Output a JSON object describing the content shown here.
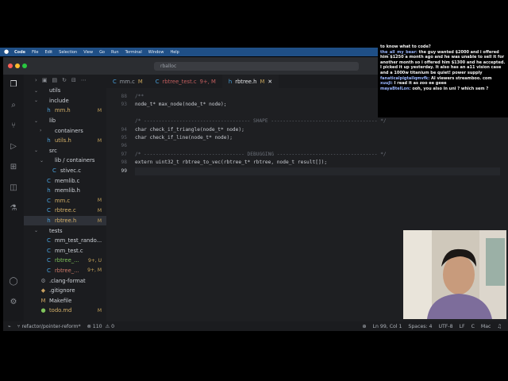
{
  "menubar": {
    "app": "Code",
    "items": [
      "File",
      "Edit",
      "Selection",
      "View",
      "Go",
      "Run",
      "Terminal",
      "Window",
      "Help"
    ]
  },
  "search": {
    "placeholder": "rballoc"
  },
  "sidebar": {
    "rows": [
      {
        "label": "utils",
        "type": "folder",
        "open": true,
        "level": 1,
        "badge": ""
      },
      {
        "label": "include",
        "type": "folder",
        "open": true,
        "level": 1,
        "badge": ""
      },
      {
        "label": "mm.h",
        "type": "h",
        "level": 2,
        "badge": "M"
      },
      {
        "label": "lib",
        "type": "folder",
        "open": true,
        "level": 1,
        "badge": ""
      },
      {
        "label": "containers",
        "type": "folder",
        "open": false,
        "level": 2,
        "badge": ""
      },
      {
        "label": "utils.h",
        "type": "h",
        "level": 2,
        "badge": "M"
      },
      {
        "label": "src",
        "type": "folder",
        "open": true,
        "level": 1,
        "badge": ""
      },
      {
        "label": "lib / containers",
        "type": "folder",
        "open": true,
        "level": 2,
        "badge": ""
      },
      {
        "label": "stivec.c",
        "type": "c",
        "level": 3,
        "badge": ""
      },
      {
        "label": "memlib.c",
        "type": "c",
        "level": 2,
        "badge": ""
      },
      {
        "label": "memlib.h",
        "type": "h",
        "level": 2,
        "badge": ""
      },
      {
        "label": "mm.c",
        "type": "c",
        "level": 2,
        "badge": "M"
      },
      {
        "label": "rbtree.c",
        "type": "c",
        "level": 2,
        "badge": "M"
      },
      {
        "label": "rbtree.h",
        "type": "h",
        "level": 2,
        "badge": "M",
        "active": true
      },
      {
        "label": "tests",
        "type": "folder",
        "open": true,
        "level": 1,
        "badge": ""
      },
      {
        "label": "mm_test_rando...",
        "type": "c",
        "level": 2,
        "badge": ""
      },
      {
        "label": "mm_test.c",
        "type": "c",
        "level": 2,
        "badge": ""
      },
      {
        "label": "rbtree_...",
        "type": "c",
        "level": 2,
        "badge": "9+, U"
      },
      {
        "label": "rbtree_...",
        "type": "c",
        "level": 2,
        "badge": "9+, M"
      },
      {
        "label": ".clang-format",
        "type": "cfg",
        "level": 1,
        "badge": ""
      },
      {
        "label": ".gitignore",
        "type": "git",
        "level": 1,
        "badge": ""
      },
      {
        "label": "Makefile",
        "type": "make",
        "level": 1,
        "badge": ""
      },
      {
        "label": "todo.md",
        "type": "md",
        "level": 1,
        "badge": "M"
      }
    ]
  },
  "tabs": [
    {
      "icon": "C",
      "name": "mm.c",
      "status": "M",
      "active": false
    },
    {
      "icon": "C",
      "name": "rbtree_test.c",
      "status": "9+, M",
      "active": false
    },
    {
      "icon": "h",
      "name": "rbtree.h",
      "status": "M",
      "active": true
    }
  ],
  "code": {
    "lines": [
      {
        "n": "88",
        "text": "/**",
        "kind": "cm"
      },
      {
        "n": "93",
        "text": "node_t* max_node(node_t* node);",
        "kind": "code"
      },
      {
        "n": "",
        "text": "",
        "kind": "code"
      },
      {
        "n": "",
        "text": "/* ------------------------------------ SHAPE ------------------------------------ */",
        "kind": "cm"
      },
      {
        "n": "94",
        "text": "char check_if_triangle(node_t* node);",
        "kind": "code"
      },
      {
        "n": "95",
        "text": "char check_if_line(node_t* node);",
        "kind": "code"
      },
      {
        "n": "96",
        "text": "",
        "kind": "code"
      },
      {
        "n": "97",
        "text": "/* ---------------------------------- DEBUGGING ---------------------------------- */",
        "kind": "cm"
      },
      {
        "n": "98",
        "text": "extern uint32_t rbtree_to_vec(rbtree_t* rbtree, node_t result[]);",
        "kind": "code"
      },
      {
        "n": "99",
        "text": "",
        "kind": "cur"
      }
    ]
  },
  "statusbar": {
    "branch": "refactor/pointer-reform*",
    "problems": "110",
    "warnings": "0",
    "position": "Ln 99, Col 1",
    "spaces": "Spaces: 4",
    "encoding": "UTF-8",
    "eol": "LF",
    "lang": "C",
    "platform": "Mac"
  },
  "chat": {
    "lines": [
      {
        "user": "",
        "text": "to know what to code?"
      },
      {
        "user": "the_all_my_bear:",
        "text": "the guy wanted $2000 and i offered him $1250 a month ago and he was unable to sell it for another month so i offered him $1300 and he accepted. I picked it up yesterday. It also has an a11 vision case and a 1000w titanium be quiet! power supply"
      },
      {
        "user": "fanaticalpigtailqmvfk:",
        "text": "AI viewers streamboo. com"
      },
      {
        "user": "xuuJi:",
        "text": "I read it as zoo ee geee"
      },
      {
        "user": "mayaBtelLon:",
        "text": "ooh, you also in uni ? which sem ?"
      }
    ]
  },
  "colors": {
    "menubar": "#1f4f86",
    "editor_bg": "#1e1f22",
    "accent_green": "#7fc35b",
    "modified": "#c6a35a"
  }
}
